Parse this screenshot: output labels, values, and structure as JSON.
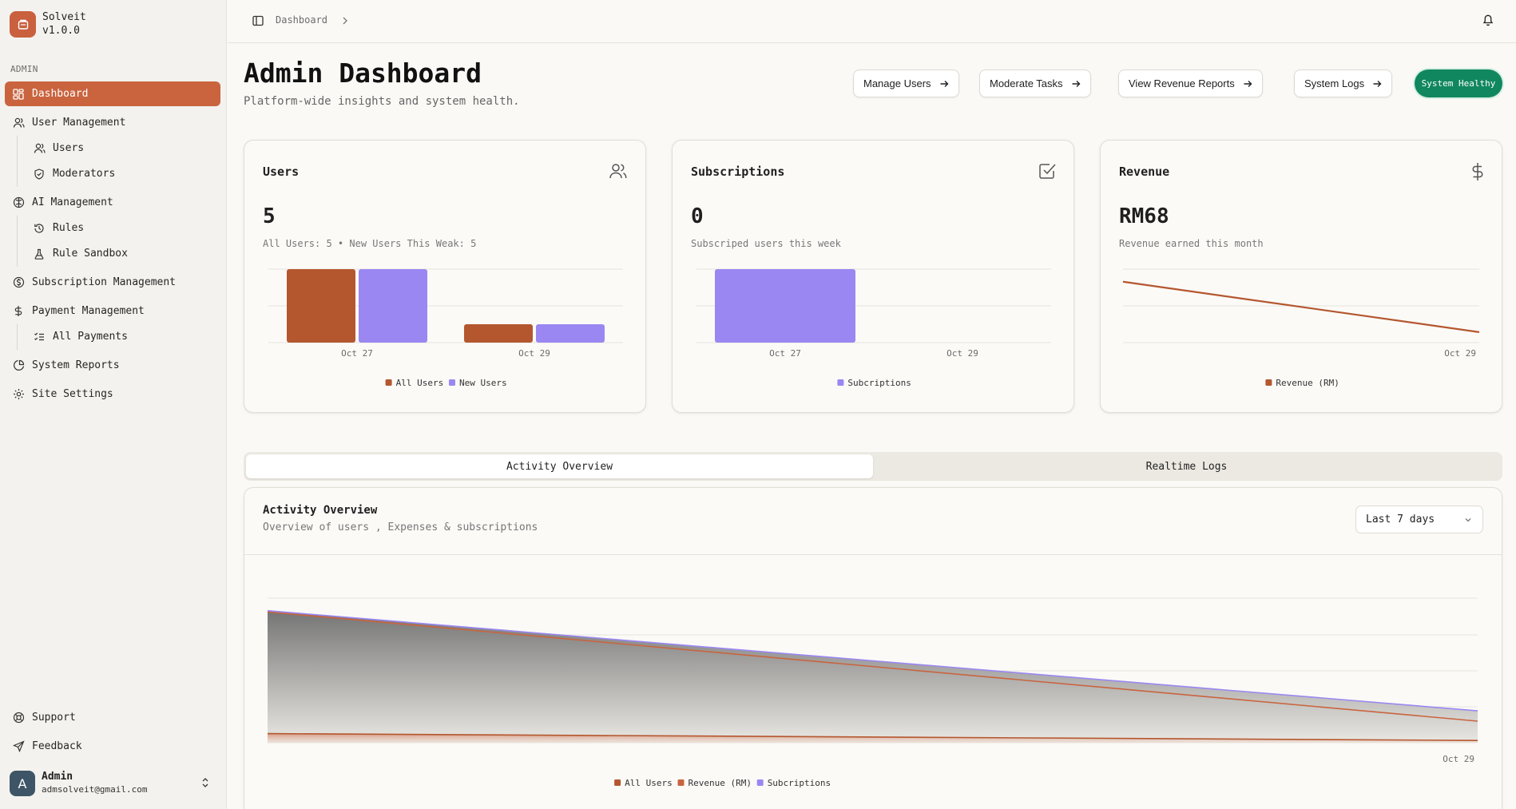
{
  "app": {
    "name": "Solveit",
    "version": "v1.0.0"
  },
  "sidebar": {
    "section": "ADMIN",
    "items": [
      {
        "label": "Dashboard",
        "icon": "layout-grid-icon"
      },
      {
        "label": "User Management",
        "icon": "users-icon"
      },
      {
        "label": "Users",
        "icon": "users-icon"
      },
      {
        "label": "Moderators",
        "icon": "shield-check-icon"
      },
      {
        "label": "AI Management",
        "icon": "brain-icon"
      },
      {
        "label": "Rules",
        "icon": "history-icon"
      },
      {
        "label": "Rule Sandbox",
        "icon": "flask-icon"
      },
      {
        "label": "Subscription Management",
        "icon": "coin-icon"
      },
      {
        "label": "Payment Management",
        "icon": "dollar-icon"
      },
      {
        "label": "All Payments",
        "icon": "list-checks-icon"
      },
      {
        "label": "System Reports",
        "icon": "pie-chart-icon"
      },
      {
        "label": "Site Settings",
        "icon": "gear-icon"
      }
    ],
    "footer": [
      {
        "label": "Support",
        "icon": "life-buoy-icon"
      },
      {
        "label": "Feedback",
        "icon": "send-icon"
      }
    ],
    "user": {
      "initial": "A",
      "name": "Admin",
      "email": "admsolveit@gmail.com"
    }
  },
  "topbar": {
    "breadcrumb": "Dashboard"
  },
  "header": {
    "title": "Admin Dashboard",
    "subtitle": "Platform-wide insights and system health.",
    "actions": [
      "Manage Users",
      "Moderate Tasks",
      "View Revenue Reports",
      "System Logs"
    ],
    "status": "System Healthy"
  },
  "cards": [
    {
      "title": "Users",
      "value": "5",
      "desc": "All Users: 5 • New Users This Weak: 5",
      "icon": "users-icon"
    },
    {
      "title": "Subscriptions",
      "value": "0",
      "desc": "Subscriped users this week",
      "icon": "check-square-icon"
    },
    {
      "title": "Revenue",
      "value": "RM68",
      "desc": "Revenue earned this month",
      "icon": "dollar-icon"
    }
  ],
  "tabs": [
    "Activity Overview",
    "Realtime Logs"
  ],
  "activity": {
    "title": "Activity Overview",
    "subtitle": "Overview of users , Expenses & subscriptions",
    "range": "Last 7 days"
  },
  "colors": {
    "accent": "#c9643f",
    "series_a": "#b4572f",
    "series_b": "#9b87f2",
    "healthy": "#11875f"
  },
  "chart_data": [
    {
      "type": "bar",
      "categories": [
        "Oct 27",
        "Oct 29"
      ],
      "series": [
        {
          "name": "All Users",
          "values": [
            4,
            1
          ],
          "color": "#b4572f"
        },
        {
          "name": "New Users",
          "values": [
            4,
            1
          ],
          "color": "#9b87f2"
        }
      ],
      "ylim": [
        0,
        4
      ]
    },
    {
      "type": "bar",
      "categories": [
        "Oct 27",
        "Oct 29"
      ],
      "series": [
        {
          "name": "Subcriptions",
          "values": [
            1,
            0
          ],
          "color": "#9b87f2"
        }
      ],
      "ylim": [
        0,
        1
      ]
    },
    {
      "type": "line",
      "x": [
        "",
        "Oct 29"
      ],
      "series": [
        {
          "name": "Revenue (RM)",
          "values": [
            58,
            10
          ],
          "color": "#b4572f"
        }
      ],
      "ylim": [
        0,
        70
      ]
    },
    {
      "type": "area",
      "x": [
        "",
        "Oct 29"
      ],
      "series": [
        {
          "name": "All Users",
          "values": [
            4,
            1
          ],
          "color": "#b4572f"
        },
        {
          "name": "Revenue (RM)",
          "values": [
            58,
            10
          ],
          "color": "#c9643f"
        },
        {
          "name": "Subcriptions",
          "values": [
            58,
            14
          ],
          "color": "#9b87f2"
        }
      ],
      "ylim": [
        0,
        60
      ]
    }
  ]
}
